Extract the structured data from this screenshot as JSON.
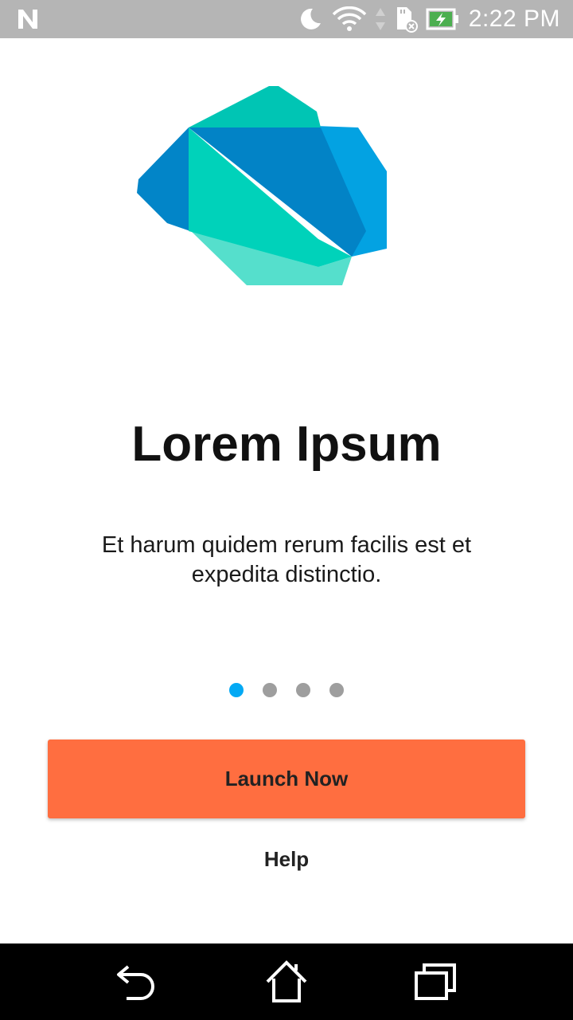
{
  "status_bar": {
    "time": "2:22 PM",
    "icons": [
      "notification-n-icon",
      "moon-icon",
      "wifi-icon",
      "sd-card-icon",
      "battery-charging-icon"
    ]
  },
  "onboarding": {
    "title": "Lorem Ipsum",
    "description": "Et harum quidem rerum facilis est et expedita distinctio.",
    "page_count": 4,
    "current_page": 1
  },
  "actions": {
    "launch_label": "Launch Now",
    "help_label": "Help"
  },
  "colors": {
    "accent": "#ff6e40",
    "dot_active": "#03a9f4",
    "dot_inactive": "#9e9e9e",
    "status_bar": "#b5b5b5",
    "nav_bar": "#000000"
  },
  "nav_bar": {
    "icons": [
      "back-icon",
      "home-icon",
      "recents-icon"
    ]
  }
}
